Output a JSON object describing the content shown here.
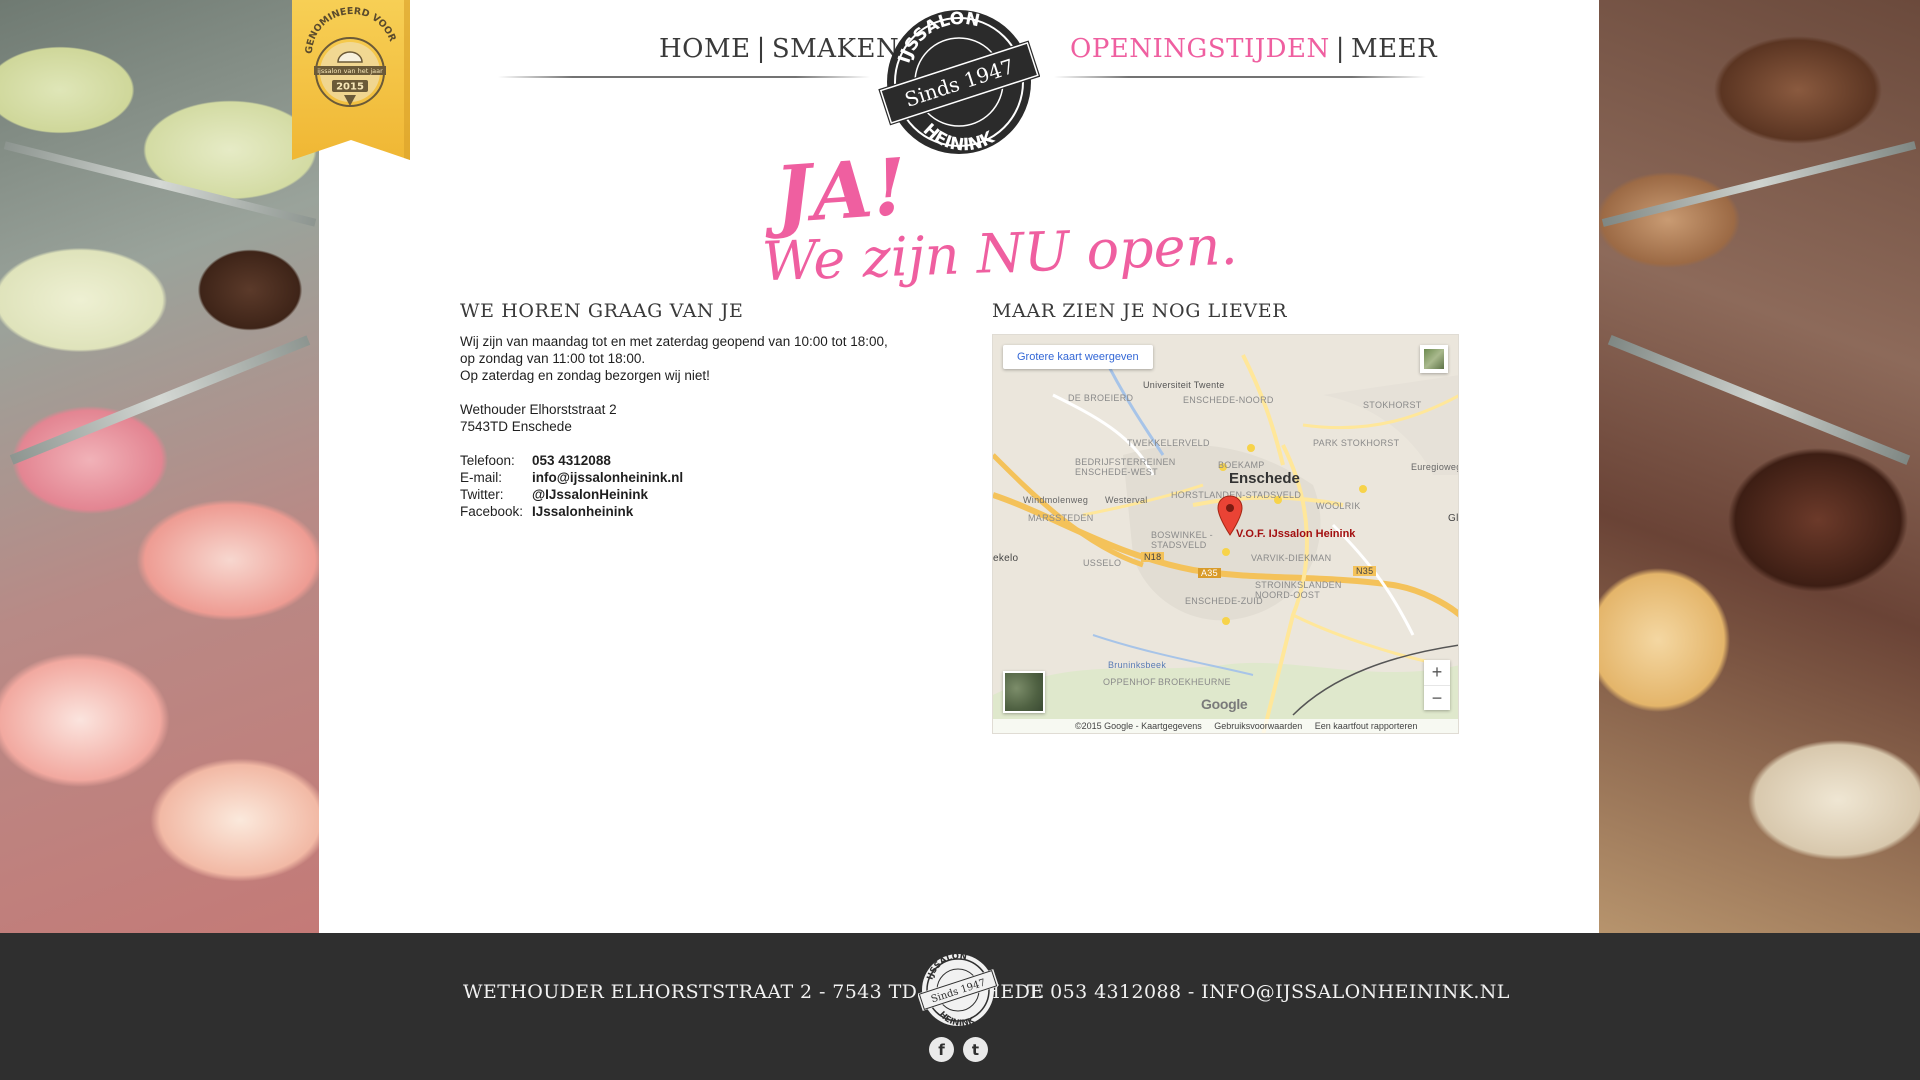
{
  "nav": {
    "home": "HOME",
    "smaken": "SMAKEN",
    "openingstijden": "OPENINGSTIJDEN",
    "meer": "MEER",
    "separator": "|"
  },
  "badge": {
    "top_text": "GENOMINEERD VOOR",
    "middle_text": "ijssalon van het jaar",
    "year": "2015"
  },
  "logo": {
    "top": "IJSSALON",
    "middle": "Sinds 1947",
    "bottom": "HEININK"
  },
  "slogan": {
    "line1": "JA!",
    "line2": "We zijn NU open."
  },
  "contact_section": {
    "title": "WE HOREN GRAAG VAN JE",
    "hours_line1": "Wij zijn van maandag tot en met zaterdag geopend van 10:00 tot 18:00,",
    "hours_line2": "op zondag van 11:00 tot 18:00.",
    "hours_line3": "Op zaterdag en zondag bezorgen wij niet!",
    "address_line1": "Wethouder Elhorststraat 2",
    "address_line2": "7543TD Enschede",
    "phone_label": "Telefoon:",
    "phone_value": "053 4312088",
    "email_label": "E-mail:",
    "email_value": "info@ijssalonheinink.nl",
    "twitter_label": "Twitter:",
    "twitter_value": "@IJssalonHeinink",
    "facebook_label": "Facebook:",
    "facebook_value": "IJssalonheinink"
  },
  "map_section": {
    "title": "MAAR ZIEN JE NOG LIEVER",
    "bigger_map_link": "Grotere kaart weergeven",
    "zoom_in": "+",
    "zoom_out": "−",
    "city_label": "Enschede",
    "poi_label": "V.O.F. IJssalon Heinink",
    "google_wordmark": "Google",
    "footer_copyright": "©2015 Google - Kaartgegevens",
    "footer_terms": "Gebruiksvoorwaarden",
    "footer_report": "Een kaartfout rapporteren",
    "place_labels": [
      "Universiteit Twente",
      "DE BROEIERD",
      "ENSCHEDE-NOORD",
      "STOKHORST",
      "TWEKKELERVELD",
      "PARK STOKHORST",
      "BEDRIJFSTERREINEN ENSCHEDE-WEST",
      "BOEKAMP",
      "Euregioweg",
      "Windmolenweg",
      "Westerval",
      "HORSTLANDEN-STADSVELD",
      "WOOLRIK",
      "MARSSTEDEN",
      "BOSWINKEL - STADSVELD",
      "N18",
      "A35",
      "VARVIK-DIEKMAN",
      "N35",
      "USSELO",
      "STROINKSLANDEN NOORD-OOST",
      "ENSCHEDE-ZUID",
      "Bruninksbeek",
      "BROEKHEURNE",
      "OPPENHOF",
      "ekelo",
      "Glanerbrug"
    ],
    "colors": {
      "highway": "#f4c25a",
      "major_road": "#ffe79a",
      "water": "#a7c4e8",
      "urban": "#e2ddd3",
      "park": "#cfe3b7"
    }
  },
  "footer": {
    "address": "WETHOUDER ELHORSTSTRAAT 2 - 7543 TD ENSCHEDE",
    "contact": "T. 053 4312088 - INFO@IJSSALONHEININK.NL",
    "facebook_icon_glyph": "f",
    "twitter_icon_glyph": "t"
  },
  "colors": {
    "accent_pink": "#ef5fa0",
    "text_dark": "#3a3a3a",
    "footer_bg": "#2f2f2f",
    "badge_gold": "#f5c342"
  }
}
